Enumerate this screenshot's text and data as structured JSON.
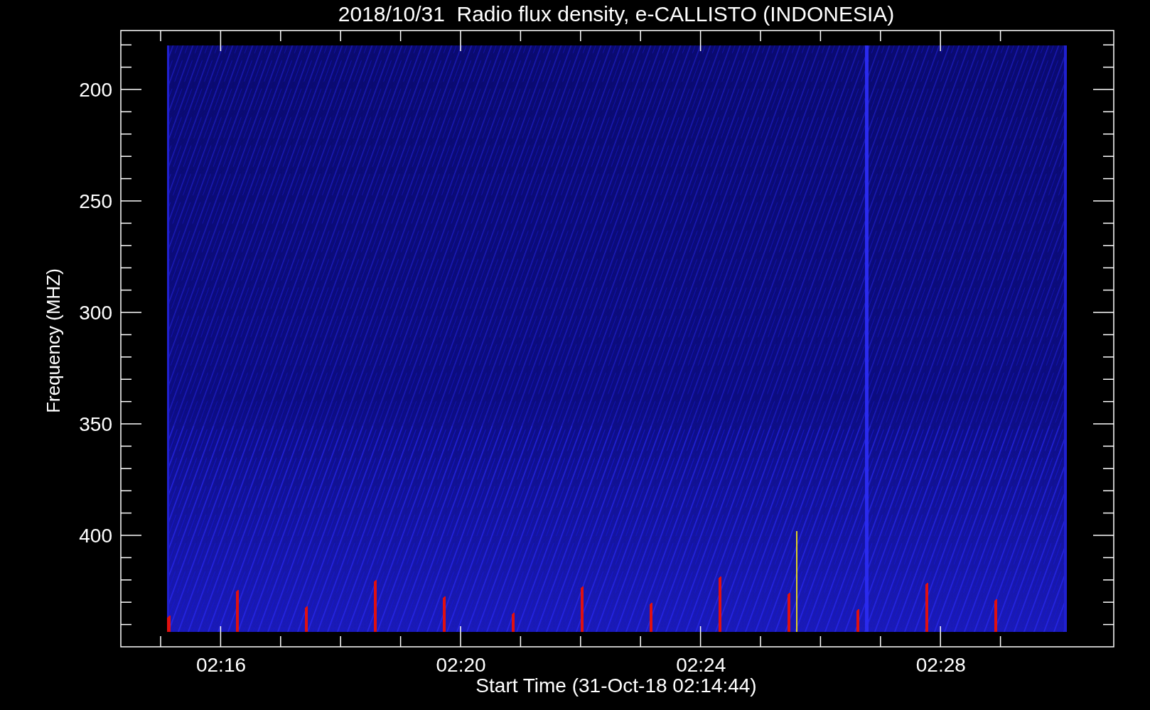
{
  "title": "2018/10/31  Radio flux density, e-CALLISTO (INDONESIA)",
  "y_axis": {
    "label": "Frequency (MHZ)",
    "ticks": [
      "200",
      "250",
      "300",
      "350",
      "400"
    ]
  },
  "x_axis": {
    "label": "Start Time (31-Oct-18 02:14:44)",
    "ticks": [
      "02:16",
      "02:20",
      "02:24",
      "02:28"
    ]
  }
}
